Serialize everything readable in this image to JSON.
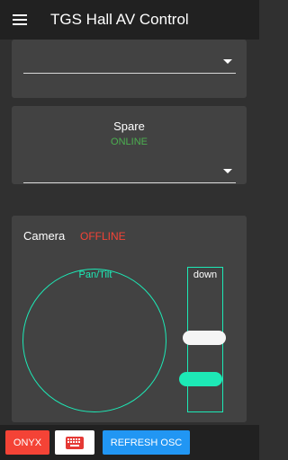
{
  "app": {
    "title": "TGS Hall AV Control"
  },
  "cards": {
    "first": {
      "selected_value": ""
    },
    "spare": {
      "name": "Spare",
      "status": "ONLINE",
      "selected_value": ""
    },
    "camera": {
      "name": "Camera",
      "status": "OFFLINE",
      "pantilt_label": "Pan/Tilt",
      "slider_label": "down"
    }
  },
  "bottom": {
    "onyx_label": "ONYX",
    "refresh_label": "REFRESH OSC"
  },
  "icons": {
    "menu": "menu-icon",
    "dropdown": "chevron-down-icon",
    "keyboard": "keyboard-icon"
  },
  "colors": {
    "accent": "#1de9b6",
    "online": "#4caf50",
    "offline": "#f44336",
    "onyx": "#f44336",
    "refresh": "#2196f3"
  }
}
